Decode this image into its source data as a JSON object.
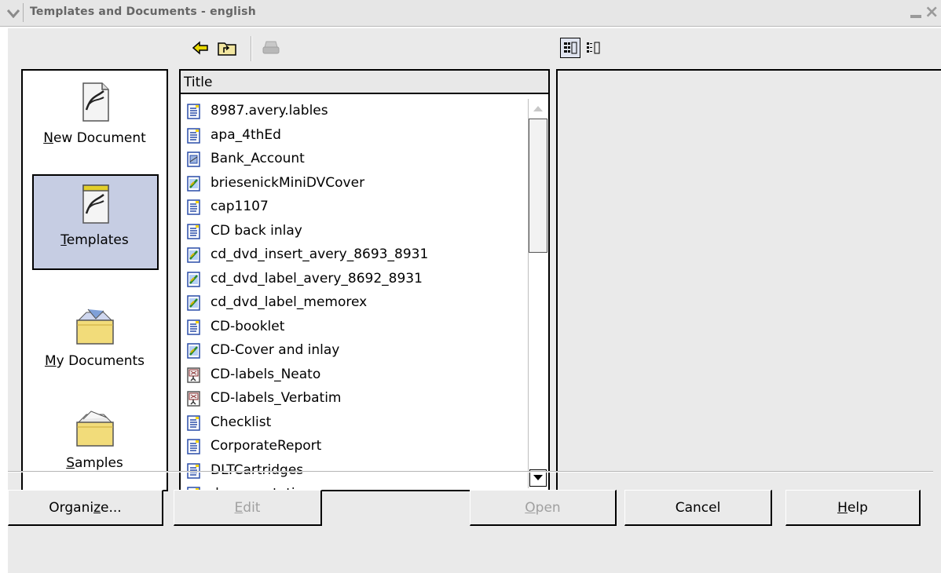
{
  "window": {
    "title": "Templates and Documents - english"
  },
  "categories": [
    {
      "id": "new-document",
      "label_pre": "",
      "label_key": "N",
      "label_post": "ew Document",
      "icon": "new-document-icon",
      "selected": false
    },
    {
      "id": "templates",
      "label_pre": "",
      "label_key": "T",
      "label_post": "emplates",
      "icon": "templates-icon",
      "selected": true
    },
    {
      "id": "my-documents",
      "label_pre": "",
      "label_key": "M",
      "label_post": "y Documents",
      "icon": "folder-icon",
      "selected": false
    },
    {
      "id": "samples",
      "label_pre": "",
      "label_key": "S",
      "label_post": "amples",
      "icon": "folder-icon",
      "selected": false
    }
  ],
  "list": {
    "header": "Title",
    "items": [
      {
        "name": "8987.avery.lables",
        "icon": "text-doc-icon"
      },
      {
        "name": "apa_4thEd",
        "icon": "text-doc-icon"
      },
      {
        "name": "Bank_Account",
        "icon": "spreadsheet-icon"
      },
      {
        "name": "briesenickMiniDVCover",
        "icon": "drawing-icon"
      },
      {
        "name": "cap1107",
        "icon": "text-doc-icon"
      },
      {
        "name": "CD back inlay",
        "icon": "text-doc-icon"
      },
      {
        "name": "cd_dvd_insert_avery_8693_8931",
        "icon": "drawing-icon"
      },
      {
        "name": "cd_dvd_label_avery_8692_8931",
        "icon": "drawing-icon"
      },
      {
        "name": "cd_dvd_label_memorex",
        "icon": "drawing-icon"
      },
      {
        "name": "CD-booklet",
        "icon": "text-doc-icon"
      },
      {
        "name": "CD-Cover and inlay",
        "icon": "drawing-icon"
      },
      {
        "name": "CD-labels_Neato",
        "icon": "presentation-icon"
      },
      {
        "name": "CD-labels_Verbatim",
        "icon": "presentation-icon"
      },
      {
        "name": "Checklist",
        "icon": "text-doc-icon"
      },
      {
        "name": "CorporateReport",
        "icon": "text-doc-icon"
      },
      {
        "name": "DLTCartridges",
        "icon": "text-doc-icon"
      },
      {
        "name": "documentation",
        "icon": "text-doc-icon"
      }
    ]
  },
  "buttons": {
    "organize": {
      "pre": "Organi",
      "key": "z",
      "post": "e..."
    },
    "edit": {
      "pre": "",
      "key": "E",
      "post": "dit"
    },
    "open": {
      "pre": "",
      "key": "O",
      "post": "pen"
    },
    "cancel": {
      "label": "Cancel"
    },
    "help": {
      "pre": "",
      "key": "H",
      "post": "elp"
    }
  },
  "colors": {
    "selection": "#c6cde3",
    "dialog_bg": "#eaeaea",
    "disabled_text": "#a0a0a0"
  }
}
